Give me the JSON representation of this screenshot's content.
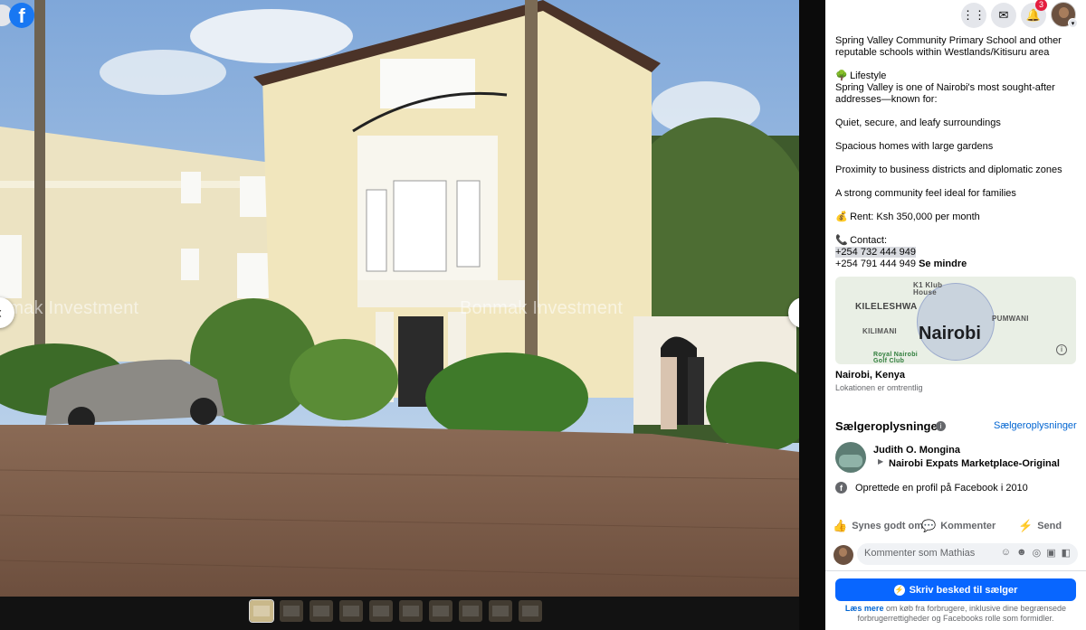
{
  "viewer": {
    "watermark": "Bonmak Investment",
    "watermark_left": "nmak Investment",
    "thumbnail_count": 10,
    "active_thumbnail": 1
  },
  "topbar": {
    "notification_count": "3"
  },
  "description": {
    "schools_line": "Spring Valley Community Primary School and other reputable schools within Westlands/Kitisuru area",
    "lifestyle_emoji": "🌳",
    "lifestyle_title": "Lifestyle",
    "lifestyle_text": "Spring Valley is one of Nairobi's most sought-after addresses—known for:",
    "features": [
      "Quiet, secure, and leafy surroundings",
      "Spacious homes with large gardens",
      "Proximity to business districts and diplomatic zones",
      "A strong community feel ideal for families"
    ],
    "rent_emoji": "💰",
    "rent": "Rent: Ksh 350,000 per month",
    "contact_emoji": "📞",
    "contact_label": "Contact:",
    "phone1": "+254 732 444 949",
    "phone2": "+254 791 444 949",
    "see_less": "Se mindre"
  },
  "map": {
    "city": "Nairobi",
    "labels": {
      "k1": "K1 Klub House",
      "kileleshwa": "KILELESHWA",
      "pumwani": "PUMWANI",
      "kilimani": "KILIMANI",
      "golf": "Royal Nairobi Golf Club"
    },
    "location": "Nairobi, Kenya",
    "location_note": "Lokationen er omtrentlig"
  },
  "seller": {
    "heading": "Sælgeroplysninger",
    "link": "Sælgeroplysninger",
    "name": "Judith O. Mongina",
    "group": "Nairobi Expats Marketplace-Original",
    "joined": "Oprettede en profil på Facebook i 2010"
  },
  "actions": {
    "like": "Synes godt om",
    "comment": "Kommenter",
    "send": "Send"
  },
  "comment": {
    "placeholder": "Kommenter som Mathias"
  },
  "cta": {
    "label": "Skriv besked til sælger"
  },
  "disclaimer": {
    "link": "Læs mere",
    "text": " om køb fra forbrugere, inklusive dine begrænsede forbrugerrettigheder og Facebooks rolle som formidler."
  }
}
